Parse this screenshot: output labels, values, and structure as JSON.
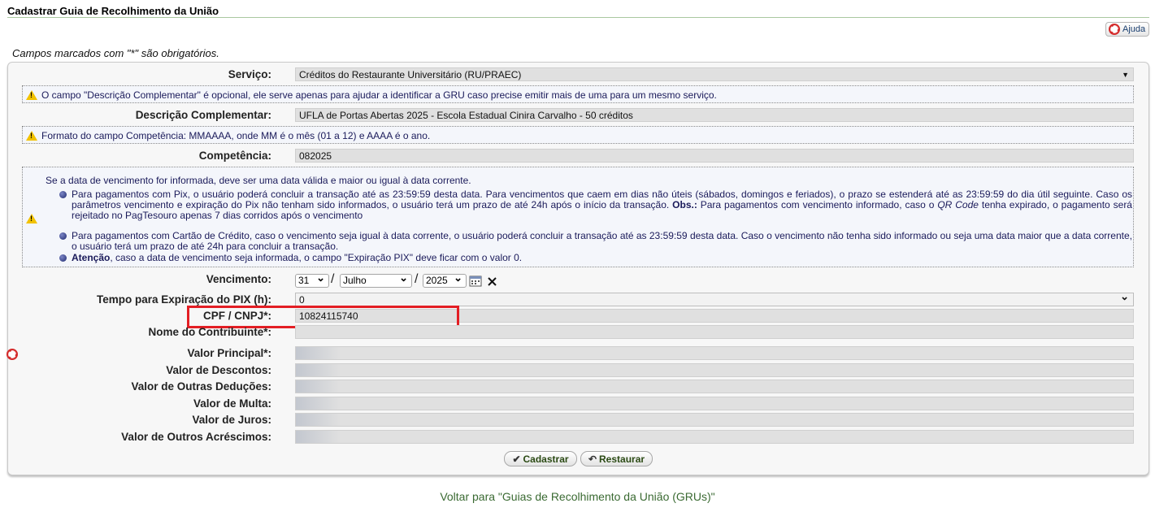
{
  "page": {
    "title": "Cadastrar Guia de Recolhimento da União",
    "help_label": "Ajuda",
    "required_note": "Campos marcados com \"*\" são obrigatórios."
  },
  "form": {
    "servico": {
      "label": "Serviço:",
      "value": "Créditos do Restaurante Universitário (RU/PRAEC)"
    },
    "info_descricao": "O campo \"Descrição Complementar\" é opcional, ele serve apenas para ajudar a identificar a GRU caso precise emitir mais de uma para um mesmo serviço.",
    "descricao": {
      "label": "Descrição Complementar:",
      "value": "UFLA de Portas Abertas 2025 - Escola Estadual Cinira Carvalho - 50 créditos"
    },
    "info_competencia": "Formato do campo Competência: MMAAAA, onde MM é o mês (01 a 12) e AAAA é o ano.",
    "competencia": {
      "label": "Competência:",
      "value": "082025"
    },
    "info_vencimento": {
      "intro": "Se a data de vencimento for informada, deve ser uma data válida e maior ou igual à data corrente.",
      "pix_a": "Para pagamentos com Pix, o usuário poderá concluir a transação até as 23:59:59 desta data. Para vencimentos que caem em dias não úteis (sábados, domingos e feriados), o prazo se estenderá até as 23:59:59 do dia útil seguinte. Caso os parâmetros vencimento e expiração do Pix não tenham sido informados, o usuário terá um prazo de até 24h após o início da transação.",
      "pix_obs_label": "Obs.:",
      "pix_b": "Para pagamentos com vencimento informado, caso o",
      "pix_qr": "QR Code",
      "pix_c": "tenha expirado, o pagamento será rejeitado no PagTesouro apenas 7 dias corridos após o vencimento",
      "cartao": "Para pagamentos com Cartão de Crédito, caso o vencimento seja igual à data corrente, o usuário poderá concluir a transação até as 23:59:59 desta data. Caso o vencimento não tenha sido informado ou seja uma data maior que a data corrente, o usuário terá um prazo de até 24h para concluir a transação.",
      "atencao_label": "Atenção",
      "atencao_text": ", caso a data de vencimento seja informada, o campo \"Expiração PIX\" deve ficar com o valor 0."
    },
    "vencimento": {
      "label": "Vencimento:",
      "day": "31",
      "month": "Julho",
      "year": "2025"
    },
    "expiracao_pix": {
      "label": "Tempo para Expiração do PIX (h):",
      "value": "0"
    },
    "cpf_cnpj": {
      "label": "CPF / CNPJ*:",
      "value": "10824115740"
    },
    "nome": {
      "label": "Nome do Contribuinte*:",
      "value": ""
    },
    "valor_principal": {
      "label": "Valor Principal*:",
      "value": ""
    },
    "valor_descontos": {
      "label": "Valor de Descontos:",
      "value": ""
    },
    "valor_deducoes": {
      "label": "Valor de Outras Deduções:",
      "value": ""
    },
    "valor_multa": {
      "label": "Valor de Multa:",
      "value": ""
    },
    "valor_juros": {
      "label": "Valor de Juros:",
      "value": ""
    },
    "valor_acrescimos": {
      "label": "Valor de Outros Acréscimos:",
      "value": ""
    }
  },
  "actions": {
    "cadastrar": "Cadastrar",
    "restaurar": "Restaurar"
  },
  "footer": {
    "back_link": "Voltar para \"Guias de Recolhimento da União (GRUs)\""
  }
}
